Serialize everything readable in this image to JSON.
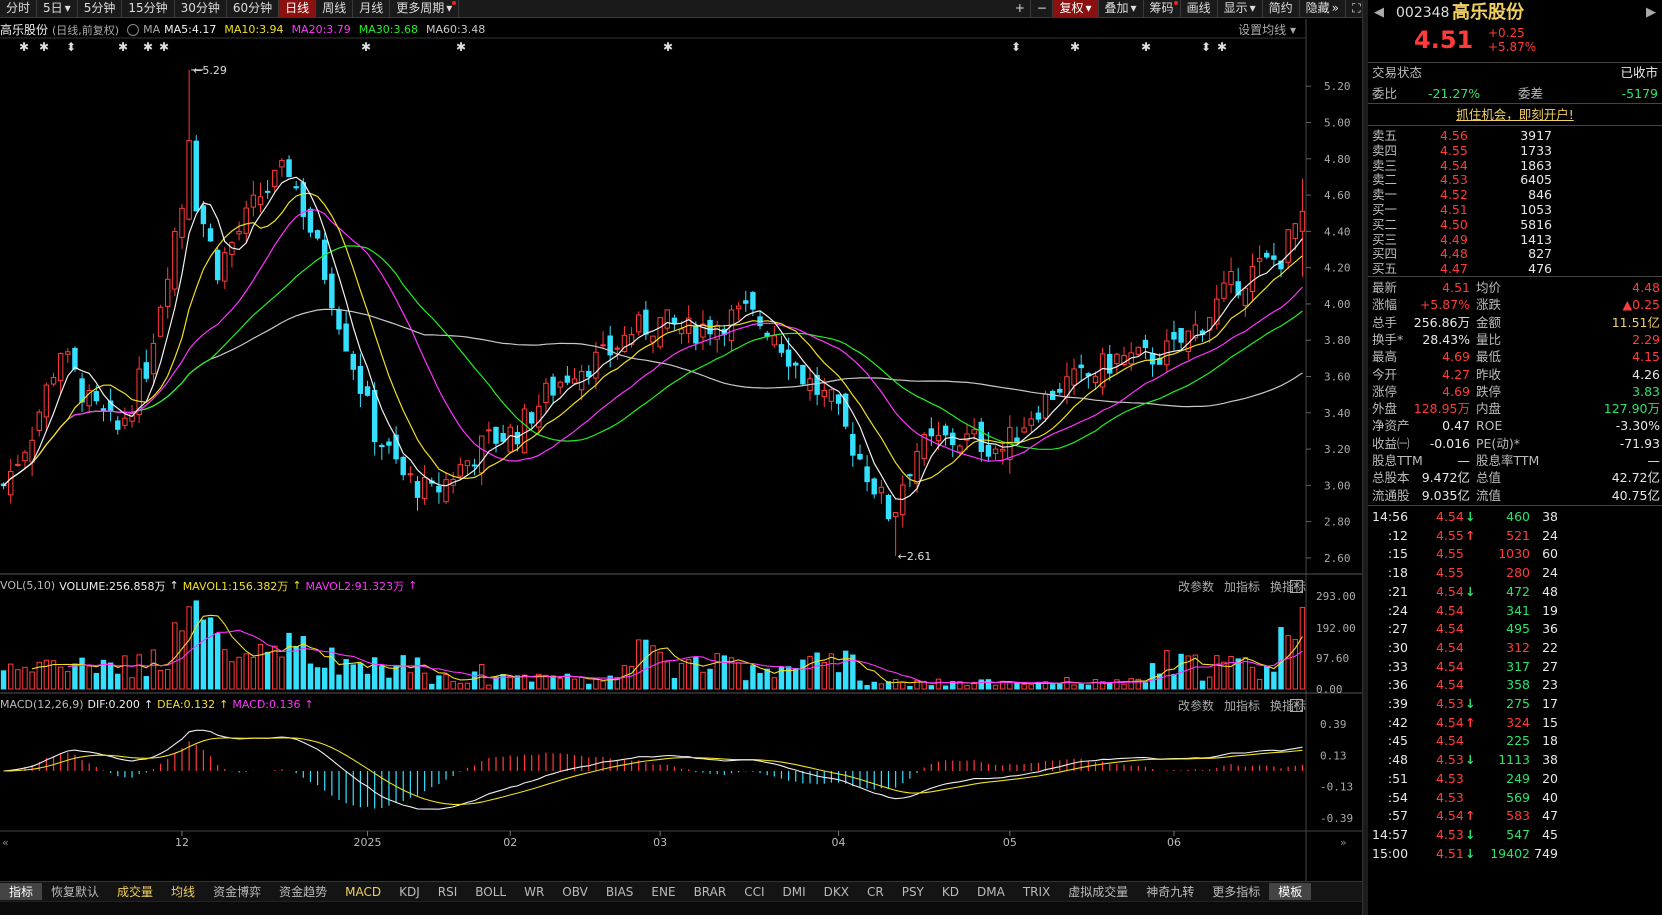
{
  "toolbar": {
    "items": [
      {
        "label": "分时",
        "selected": false,
        "dot": false
      },
      {
        "label": "5日",
        "arrow": "▾",
        "selected": false,
        "dot": false
      },
      {
        "label": "5分钟",
        "selected": false,
        "dot": false
      },
      {
        "label": "15分钟",
        "selected": false,
        "dot": false
      },
      {
        "label": "30分钟",
        "selected": false,
        "dot": false
      },
      {
        "label": "60分钟",
        "selected": false,
        "dot": false
      },
      {
        "label": "日线",
        "selected": true,
        "dot": false
      },
      {
        "label": "周线",
        "selected": false,
        "dot": false
      },
      {
        "label": "月线",
        "selected": false,
        "dot": false
      },
      {
        "label": "更多周期",
        "arrow": "▾",
        "selected": false,
        "dot": true
      }
    ],
    "right_items": [
      {
        "label": "+",
        "sq": true
      },
      {
        "label": "−",
        "sq": true
      },
      {
        "label": "复权",
        "arrow": "▾",
        "selected": true
      },
      {
        "label": "叠加",
        "arrow": "▾"
      },
      {
        "label": "筹码",
        "dot": true
      },
      {
        "label": "画线"
      },
      {
        "label": "显示",
        "arrow": "▾"
      },
      {
        "label": "简约"
      },
      {
        "label": "隐藏",
        "arrow": "»"
      },
      {
        "label": "⛶",
        "sq": true
      }
    ]
  },
  "main_title": {
    "name": "高乐股份",
    "mode": "(日线,前复权)",
    "ma_label": "MA",
    "ma": [
      {
        "label": "MA5:4.17",
        "color": "#f2f2f2"
      },
      {
        "label": "MA10:3.94",
        "color": "#f0e020"
      },
      {
        "label": "MA20:3.79",
        "color": "#ff33ff"
      },
      {
        "label": "MA30:3.68",
        "color": "#22ee22"
      },
      {
        "label": "MA60:3.48",
        "color": "#c8c8c8"
      }
    ],
    "settings": "设置均线"
  },
  "main_axis": [
    "5.20",
    "5.00",
    "4.80",
    "4.60",
    "4.40",
    "4.20",
    "4.00",
    "3.80",
    "3.60",
    "3.40",
    "3.20",
    "3.00",
    "2.80",
    "2.60"
  ],
  "high_label": "5.29",
  "low_label": "2.61",
  "vol_title": {
    "name": "VOL(5,10)",
    "volume": "VOLUME:256.858万",
    "mavol1": "MAVOL1:156.382万",
    "mavol2": "MAVOL2:91.323万"
  },
  "vol_axis": [
    "293.00",
    "192.00",
    "97.60",
    "0.00"
  ],
  "macd_title": {
    "name": "MACD(12,26,9)",
    "dif": "DIF:0.200",
    "dea": "DEA:0.132",
    "macd": "MACD:0.136"
  },
  "macd_axis": [
    "0.39",
    "0.13",
    "-0.13",
    "-0.39"
  ],
  "panel_buttons": [
    "改参数",
    "加指标",
    "换指标"
  ],
  "close_glyph": "×",
  "x_labels": [
    {
      "label": "12",
      "i": 25
    },
    {
      "label": "2025",
      "i": 51
    },
    {
      "label": "02",
      "i": 71
    },
    {
      "label": "03",
      "i": 92
    },
    {
      "label": "04",
      "i": 117
    },
    {
      "label": "05",
      "i": 141
    },
    {
      "label": "06",
      "i": 164
    }
  ],
  "bottom_tabs": [
    {
      "label": "指标",
      "active": true
    },
    {
      "label": "恢复默认"
    },
    {
      "label": "成交量",
      "yellow": true
    },
    {
      "label": "均线",
      "yellow": true
    },
    {
      "label": "资金博弈"
    },
    {
      "label": "资金趋势"
    },
    {
      "label": "MACD",
      "yellow": true
    },
    {
      "label": "KDJ"
    },
    {
      "label": "RSI"
    },
    {
      "label": "BOLL"
    },
    {
      "label": "WR"
    },
    {
      "label": "OBV"
    },
    {
      "label": "BIAS"
    },
    {
      "label": "ENE"
    },
    {
      "label": "BRAR"
    },
    {
      "label": "CCI"
    },
    {
      "label": "DMI"
    },
    {
      "label": "DKX"
    },
    {
      "label": "CR"
    },
    {
      "label": "PSY"
    },
    {
      "label": "KD"
    },
    {
      "label": "DMA"
    },
    {
      "label": "TRIX"
    },
    {
      "label": "虚拟成交量"
    },
    {
      "label": "神奇九转"
    },
    {
      "label": "更多指标"
    },
    {
      "label": "模板",
      "active": true
    }
  ],
  "colors": {
    "up": "#ff3b3b",
    "down": "#35e0ff",
    "ma5": "#f2f2f2",
    "ma10": "#f0e020",
    "ma20": "#ff33ff",
    "ma30": "#22ee22",
    "ma60": "#c8c8c8"
  },
  "chart_data": {
    "type": "candlestick",
    "ma_periods": [
      5,
      10,
      20,
      30,
      60
    ],
    "notes_markers_count": 16,
    "price_range": [
      2.55,
      5.35
    ],
    "start_price": 3.0,
    "series": "generated"
  },
  "stock": {
    "code": "002348",
    "name": "高乐股份",
    "price": "4.51",
    "change": "+0.25",
    "pct": "+5.87%"
  },
  "status": {
    "label": "交易状态",
    "value": "已收市"
  },
  "weibi": {
    "label": "委比",
    "value": "-21.27%",
    "label2": "委差",
    "value2": "-5179"
  },
  "promo": "抓住机会，即刻开户!",
  "asks": [
    {
      "label": "卖五",
      "price": "4.56",
      "vol": "3917"
    },
    {
      "label": "卖四",
      "price": "4.55",
      "vol": "1733"
    },
    {
      "label": "卖三",
      "price": "4.54",
      "vol": "1863"
    },
    {
      "label": "卖二",
      "price": "4.53",
      "vol": "6405"
    },
    {
      "label": "卖一",
      "price": "4.52",
      "vol": "846"
    }
  ],
  "bids": [
    {
      "label": "买一",
      "price": "4.51",
      "vol": "1053"
    },
    {
      "label": "买二",
      "price": "4.50",
      "vol": "5816"
    },
    {
      "label": "买三",
      "price": "4.49",
      "vol": "1413"
    },
    {
      "label": "买四",
      "price": "4.48",
      "vol": "827"
    },
    {
      "label": "买五",
      "price": "4.47",
      "vol": "476"
    }
  ],
  "quote": [
    {
      "l1": "最新",
      "v1": "4.51",
      "c1": "red",
      "l2": "均价",
      "v2": "4.48",
      "c2": "red"
    },
    {
      "l1": "涨幅",
      "v1": "+5.87%",
      "c1": "red",
      "l2": "涨跌",
      "v2": "▲0.25",
      "c2": "red"
    },
    {
      "l1": "总手",
      "v1": "256.86万",
      "c1": "white",
      "l2": "金额",
      "v2": "11.51亿",
      "c2": "yellow"
    },
    {
      "l1": "换手*",
      "v1": "28.43%",
      "c1": "white",
      "l2": "量比",
      "v2": "2.29",
      "c2": "red"
    },
    {
      "l1": "最高",
      "v1": "4.69",
      "c1": "red",
      "l2": "最低",
      "v2": "4.15",
      "c2": "red"
    },
    {
      "l1": "今开",
      "v1": "4.27",
      "c1": "red",
      "l2": "昨收",
      "v2": "4.26",
      "c2": "white"
    },
    {
      "l1": "涨停",
      "v1": "4.69",
      "c1": "red",
      "l2": "跌停",
      "v2": "3.83",
      "c2": "green"
    },
    {
      "l1": "外盘",
      "v1": "128.95万",
      "c1": "red",
      "l2": "内盘",
      "v2": "127.90万",
      "c2": "green"
    },
    {
      "l1": "净资产",
      "v1": "0.47",
      "c1": "white",
      "l2": "ROE",
      "v2": "-3.30%",
      "c2": "white"
    },
    {
      "l1": "收益㈠",
      "v1": "-0.016",
      "c1": "white",
      "l2": "PE(动)*",
      "v2": "-71.93",
      "c2": "white"
    },
    {
      "l1": "股息TTM",
      "v1": "—",
      "c1": "white",
      "l2": "股息率TTM",
      "v2": "—",
      "c2": "white"
    },
    {
      "l1": "总股本",
      "v1": "9.472亿",
      "c1": "white",
      "l2": "总值",
      "v2": "42.72亿",
      "c2": "white"
    },
    {
      "l1": "流通股",
      "v1": "9.035亿",
      "c1": "white",
      "l2": "流值",
      "v2": "40.75亿",
      "c2": "white"
    }
  ],
  "ticks": [
    {
      "t": "14:56",
      "p": "4.54",
      "a": "↓",
      "ac": "green",
      "v": "460",
      "vc": "green",
      "n": "38"
    },
    {
      "t": ":12",
      "p": "4.55",
      "a": "↑",
      "ac": "red",
      "v": "521",
      "vc": "red",
      "n": "24"
    },
    {
      "t": ":15",
      "p": "4.55",
      "a": "",
      "ac": "",
      "v": "1030",
      "vc": "red",
      "n": "60"
    },
    {
      "t": ":18",
      "p": "4.55",
      "a": "",
      "ac": "",
      "v": "280",
      "vc": "red",
      "n": "24"
    },
    {
      "t": ":21",
      "p": "4.54",
      "a": "↓",
      "ac": "green",
      "v": "472",
      "vc": "green",
      "n": "48"
    },
    {
      "t": ":24",
      "p": "4.54",
      "a": "",
      "ac": "",
      "v": "341",
      "vc": "green",
      "n": "19"
    },
    {
      "t": ":27",
      "p": "4.54",
      "a": "",
      "ac": "",
      "v": "495",
      "vc": "green",
      "n": "36"
    },
    {
      "t": ":30",
      "p": "4.54",
      "a": "",
      "ac": "",
      "v": "312",
      "vc": "red",
      "n": "22"
    },
    {
      "t": ":33",
      "p": "4.54",
      "a": "",
      "ac": "",
      "v": "317",
      "vc": "green",
      "n": "27"
    },
    {
      "t": ":36",
      "p": "4.54",
      "a": "",
      "ac": "",
      "v": "358",
      "vc": "green",
      "n": "23"
    },
    {
      "t": ":39",
      "p": "4.53",
      "a": "↓",
      "ac": "green",
      "v": "275",
      "vc": "green",
      "n": "17"
    },
    {
      "t": ":42",
      "p": "4.54",
      "a": "↑",
      "ac": "red",
      "v": "324",
      "vc": "red",
      "n": "15"
    },
    {
      "t": ":45",
      "p": "4.54",
      "a": "",
      "ac": "",
      "v": "225",
      "vc": "green",
      "n": "18"
    },
    {
      "t": ":48",
      "p": "4.53",
      "a": "↓",
      "ac": "green",
      "v": "1113",
      "vc": "green",
      "n": "38"
    },
    {
      "t": ":51",
      "p": "4.53",
      "a": "",
      "ac": "",
      "v": "249",
      "vc": "green",
      "n": "20"
    },
    {
      "t": ":54",
      "p": "4.53",
      "a": "",
      "ac": "",
      "v": "569",
      "vc": "green",
      "n": "40"
    },
    {
      "t": ":57",
      "p": "4.54",
      "a": "↑",
      "ac": "red",
      "v": "583",
      "vc": "red",
      "n": "47"
    },
    {
      "t": "14:57",
      "p": "4.53",
      "a": "↓",
      "ac": "green",
      "v": "547",
      "vc": "green",
      "n": "45"
    },
    {
      "t": "15:00",
      "p": "4.51",
      "a": "↓",
      "ac": "green",
      "v": "19402",
      "vc": "green",
      "n": "749"
    }
  ]
}
